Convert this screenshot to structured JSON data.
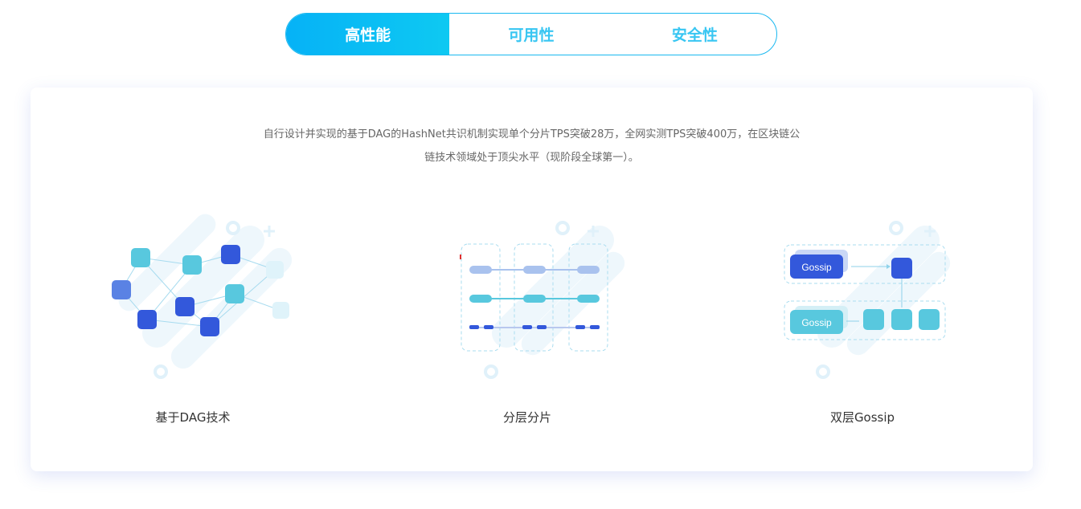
{
  "tabs": [
    {
      "label": "高性能",
      "active": true
    },
    {
      "label": "可用性",
      "active": false
    },
    {
      "label": "安全性",
      "active": false
    }
  ],
  "description": {
    "line1": "自行设计并实现的基于DAG的HashNet共识机制实现单个分片TPS突破28万，全网实测TPS突破400万，在区块链公",
    "line2": "链技术领域处于顶尖水平（现阶段全球第一）。"
  },
  "features": [
    {
      "label": "基于DAG技术",
      "icon": "dag-network-icon"
    },
    {
      "label": "分层分片",
      "icon": "sharding-layers-icon"
    },
    {
      "label": "双层Gossip",
      "icon": "gossip-layers-icon",
      "badge_top": "Gossip",
      "badge_bottom": "Gossip"
    }
  ],
  "colors": {
    "accent": "#0ab8f4",
    "dark_node": "#3358db",
    "teal_node": "#58c8de",
    "pale_node": "#dff3fa"
  }
}
